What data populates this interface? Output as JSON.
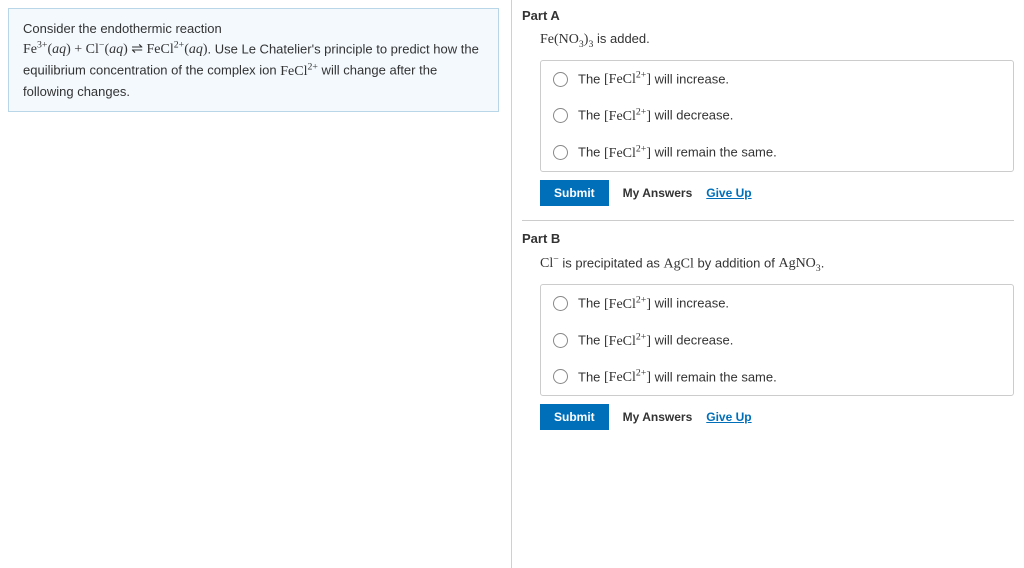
{
  "prompt": {
    "line1_pre": "Consider the endothermic reaction",
    "line2_suffix": ". Use Le Chatelier's principle to predict how the equilibrium concentration of the complex ion ",
    "line3_suffix": " will change after the following changes."
  },
  "partA": {
    "title": "Part A",
    "stem_suffix": " is added.",
    "opt1_suffix": " will increase.",
    "opt2_suffix": " will decrease.",
    "opt3_suffix": " will remain the same."
  },
  "partB": {
    "title": "Part B",
    "stem_mid": " is precipitated as ",
    "stem_mid2": " by addition of ",
    "stem_end": ".",
    "opt1_suffix": " will increase.",
    "opt2_suffix": " will decrease.",
    "opt3_suffix": " will remain the same."
  },
  "buttons": {
    "submit": "Submit",
    "my_answers": "My Answers",
    "give_up": "Give Up"
  },
  "chem": {
    "Fe3plus_aq": "Fe³⁺(aq)",
    "Clminus_aq": "Cl⁻(aq)",
    "FeCl2plus_aq": "FeCl²⁺(aq)",
    "FeCl2plus": "FeCl²⁺",
    "FeCl2plus_br": "[FeCl²⁺]",
    "FeNO33": "Fe(NO₃)₃",
    "Clminus": "Cl⁻",
    "AgCl": "AgCl",
    "AgNO3": "AgNO₃",
    "the": "The "
  }
}
